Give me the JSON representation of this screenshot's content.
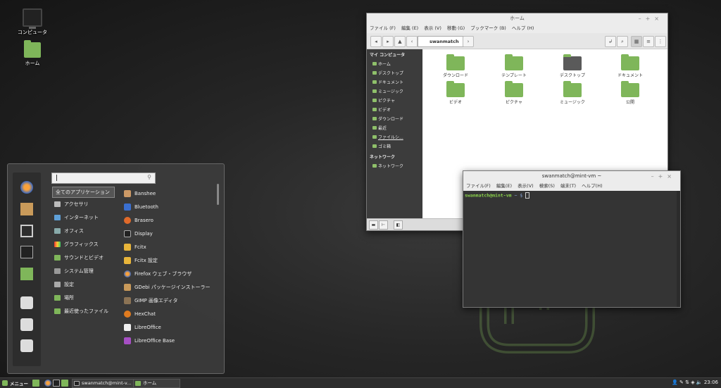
{
  "desktop": {
    "icons": [
      {
        "label": "コンピュータ",
        "icon": "computer-icon"
      },
      {
        "label": "ホーム",
        "icon": "home-folder-icon"
      }
    ]
  },
  "file_manager": {
    "title": "ホーム",
    "menu": [
      "ファイル (F)",
      "編集 (E)",
      "表示 (V)",
      "移動 (G)",
      "ブックマーク (B)",
      "ヘルプ (H)"
    ],
    "breadcrumb": "swanmatch",
    "sidebar": {
      "section1": "マイ コンピュータ",
      "items1": [
        "ホーム",
        "デスクトップ",
        "ドキュメント",
        "ミュージック",
        "ピクチャ",
        "ビデオ",
        "ダウンロード",
        "最近",
        "ファイルシ...",
        "ゴミ箱"
      ],
      "section2": "ネットワーク",
      "items2": [
        "ネットワーク"
      ]
    },
    "folders": [
      "ダウンロード",
      "テンプレート",
      "デスクトップ",
      "ドキュメント",
      "ビデオ",
      "ピクチャ",
      "ミュージック",
      "公開"
    ]
  },
  "terminal": {
    "title": "swanmatch@mint-vm ~",
    "menu": [
      "ファイル(F)",
      "編集(E)",
      "表示(V)",
      "検索(S)",
      "端末(T)",
      "ヘルプ(H)"
    ],
    "prompt": "swanmatch@mint-vm",
    "path": "~ $"
  },
  "menu": {
    "search_placeholder": "",
    "categories": [
      "全てのアプリケーション",
      "アクセサリ",
      "インターネット",
      "オフィス",
      "グラフィックス",
      "サウンドとビデオ",
      "システム管理",
      "設定",
      "場所",
      "最近使ったファイル"
    ],
    "apps": [
      "Banshee",
      "Bluetooth",
      "Brasero",
      "Display",
      "Fcitx",
      "Fcitx 設定",
      "Firefox ウェブ・ブラウザ",
      "GDebi パッケージインストーラー",
      "GIMP 画像エディタ",
      "HexChat",
      "LibreOffice",
      "LibreOffice Base"
    ]
  },
  "taskbar": {
    "menu_label": "メニュー",
    "tasks": [
      "swanmatch@mint-v...",
      "ホーム"
    ],
    "clock": "23:06"
  },
  "colors": {
    "mint_green": "#7fb65a",
    "prompt_green": "#8bd24b"
  }
}
